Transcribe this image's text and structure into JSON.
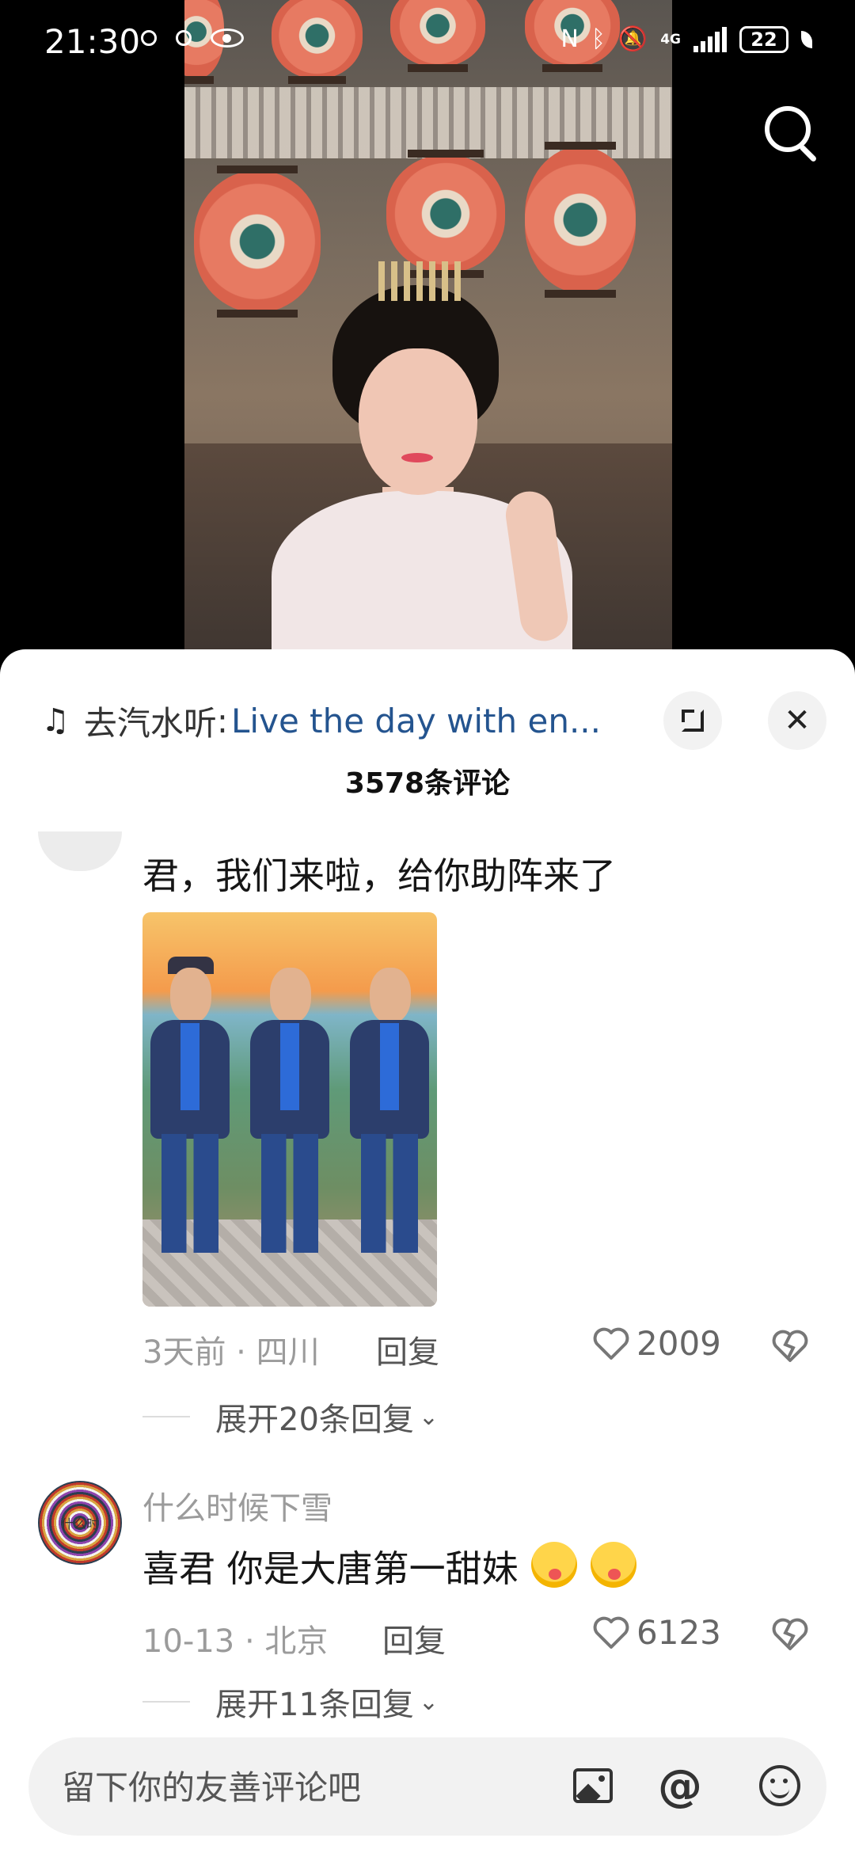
{
  "status_bar": {
    "time": "21:30",
    "network": "4G",
    "battery": "22"
  },
  "music": {
    "source": "去汽水听",
    "separator": ":",
    "song": "Live the day with en..."
  },
  "comments_header": {
    "count_label": "3578条评论"
  },
  "comments": [
    {
      "text": "君，我们来啦，给你助阵来了",
      "time": "3天前",
      "dot": "·",
      "location": "四川",
      "reply_label": "回复",
      "likes": "2009",
      "expand_label": "展开20条回复"
    },
    {
      "username": "什么时候下雪",
      "avatar_text": "什么时",
      "text": "喜君 你是大唐第一甜妹",
      "time": "10-13",
      "dot": "·",
      "location": "北京",
      "reply_label": "回复",
      "likes": "6123",
      "expand_label": "展开11条回复"
    }
  ],
  "input_bar": {
    "placeholder": "留下你的友善评论吧",
    "at_symbol": "@"
  },
  "icons": {
    "search": "search-icon",
    "expand": "expand-icon",
    "close": "close-icon",
    "heart": "heart-icon",
    "dislike": "broken-heart-icon",
    "image": "image-icon",
    "emoji": "emoji-icon"
  },
  "colors": {
    "song_link": "#24548f",
    "sheet_bg": "#ffffff",
    "meta_gray": "#9b9b9b"
  }
}
